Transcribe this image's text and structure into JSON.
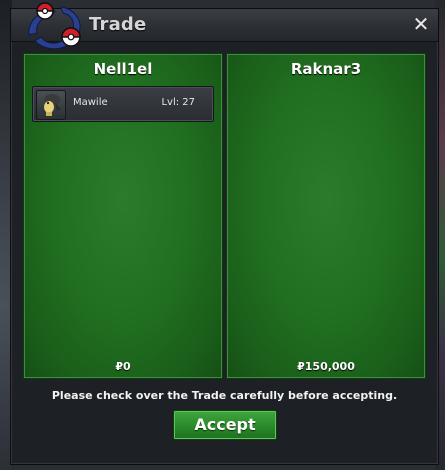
{
  "window": {
    "title": "Trade",
    "close_label": "✕"
  },
  "left_player": {
    "name": "Nell1el",
    "money": "₽0",
    "items": [
      {
        "name": "Mawile",
        "level": "Lvl: 27",
        "icon": "mawile-sprite"
      }
    ]
  },
  "right_player": {
    "name": "Raknar3",
    "money": "₽150,000",
    "items": []
  },
  "notice": "Please check over the Trade carefully before accepting.",
  "accept_label": "Accept",
  "colors": {
    "panel_green": "#217021",
    "button_green": "#2a8a2a",
    "window_bg": "#1d2024",
    "titlebar": "#2c3035",
    "logo_red": "#d1202a",
    "logo_blue": "#2a3f8f"
  }
}
